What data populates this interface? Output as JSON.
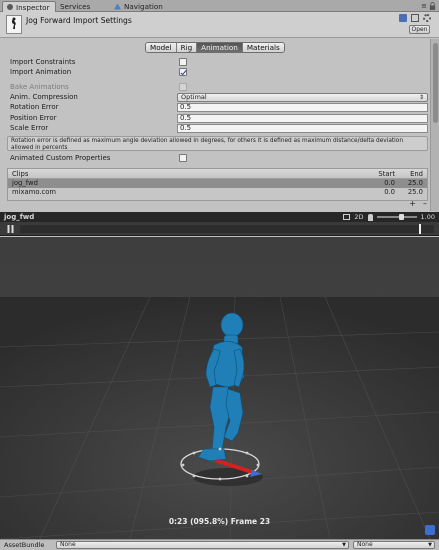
{
  "tabs": [
    {
      "label": "Inspector",
      "active": true
    },
    {
      "label": "Services",
      "active": false
    },
    {
      "label": "Navigation",
      "active": false
    }
  ],
  "inspector": {
    "title": "Jog Forward Import Settings",
    "open_label": "Open",
    "import_tabs": [
      "Model",
      "Rig",
      "Animation",
      "Materials"
    ],
    "selected_tab": "Animation",
    "import_constraints_label": "Import Constraints",
    "import_constraints": false,
    "import_animation_label": "Import Animation",
    "import_animation": true,
    "bake_animations_label": "Bake Animations",
    "anim_compression_label": "Anim. Compression",
    "anim_compression_value": "Optimal",
    "rotation_error_label": "Rotation Error",
    "rotation_error": "0.5",
    "position_error_label": "Position Error",
    "position_error": "0.5",
    "scale_error_label": "Scale Error",
    "scale_error": "0.5",
    "help_text": "Rotation error is defined as maximum angle deviation allowed in degrees, for others it is defined as maximum distance/delta deviation allowed in percents",
    "animated_custom_props_label": "Animated Custom Properties",
    "animated_custom_props": false
  },
  "clips": {
    "header": {
      "name": "Clips",
      "start": "Start",
      "end": "End"
    },
    "rows": [
      {
        "name": "jog_fwd",
        "start": "0.0",
        "end": "25.0",
        "selected": true
      },
      {
        "name": "mixamo.com",
        "start": "0.0",
        "end": "25.0",
        "selected": false
      }
    ],
    "add_label": "+",
    "remove_label": "–"
  },
  "preview": {
    "clip_name": "jog_fwd",
    "mode_2d": "2D",
    "speed": "1.00",
    "frame_text": "0:23 (095.8%) Frame 23"
  },
  "footer": {
    "label": "AssetBundle",
    "bundle_value": "None",
    "variant_value": "None"
  },
  "colors": {
    "selected_tab": "#5a5a5a",
    "character": "#1f7fb6",
    "root_arrow": "#d62020"
  }
}
